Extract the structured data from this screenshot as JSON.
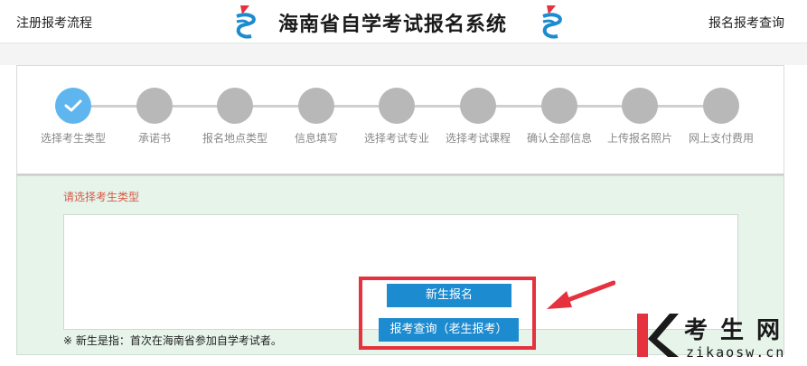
{
  "header": {
    "left_link": "注册报考流程",
    "title": "海南省自学考试报名系统",
    "right_link": "报名报考查询",
    "logo_icon": "ribbon-logo-icon"
  },
  "steps": [
    {
      "label": "选择考生类型",
      "active": true
    },
    {
      "label": "承诺书",
      "active": false
    },
    {
      "label": "报名地点类型",
      "active": false
    },
    {
      "label": "信息填写",
      "active": false
    },
    {
      "label": "选择考试专业",
      "active": false
    },
    {
      "label": "选择考试课程",
      "active": false
    },
    {
      "label": "确认全部信息",
      "active": false
    },
    {
      "label": "上传报名照片",
      "active": false
    },
    {
      "label": "网上支付费用",
      "active": false
    }
  ],
  "content": {
    "hint": "请选择考生类型",
    "new_button": "新生报名",
    "query_button": "报考查询（老生报考）",
    "note": "※ 新生是指：首次在海南省参加自学考试者。"
  },
  "watermark": {
    "chinese": "考生网",
    "english": "zikaosw.cn"
  },
  "colors": {
    "active_step": "#5fb6ee",
    "inactive_step": "#b8b8b8",
    "button": "#1d8bcf",
    "highlight": "#e5323e",
    "hint": "#d65a4a",
    "panel_bg": "#e6f4ea"
  }
}
